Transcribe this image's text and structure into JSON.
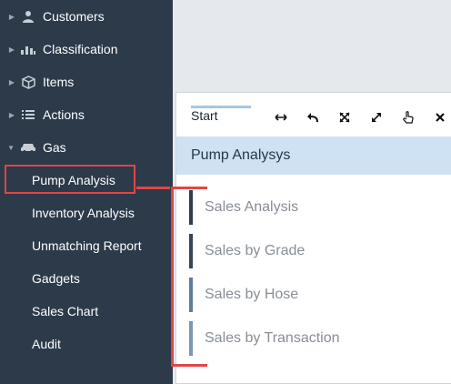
{
  "sidebar": {
    "items": [
      {
        "label": "Customers",
        "icon": "user-icon"
      },
      {
        "label": "Classification",
        "icon": "classification-icon"
      },
      {
        "label": "Items",
        "icon": "box-icon"
      },
      {
        "label": "Actions",
        "icon": "list-icon"
      },
      {
        "label": "Gas",
        "icon": "car-icon",
        "expanded": true
      }
    ],
    "gas_children": [
      {
        "label": "Pump Analysis",
        "selected": true
      },
      {
        "label": "Inventory Analysis"
      },
      {
        "label": "Unmatching Report"
      },
      {
        "label": "Gadgets"
      },
      {
        "label": "Sales Chart"
      },
      {
        "label": "Audit"
      }
    ]
  },
  "panel": {
    "tab_label": "Start",
    "toolbar": [
      "resize-horizontal-icon",
      "undo-icon",
      "fullscreen-icon",
      "expand-icon",
      "pointer-hand-icon",
      "close-icon"
    ],
    "header_title": "Pump Analysys",
    "reports": [
      {
        "label": "Sales Analysis",
        "bar_color": "#2f3e4e"
      },
      {
        "label": "Sales by Grade",
        "bar_color": "#33475b"
      },
      {
        "label": "Sales by Hose",
        "bar_color": "#5f7d9c"
      },
      {
        "label": "Sales by Transaction",
        "bar_color": "#7b97b4"
      }
    ]
  },
  "colors": {
    "sidebar_bg": "#2c3a4a",
    "highlight_red": "#e04646",
    "header_bg": "#cfe2f3",
    "canvas_bg": "#e5e9ee"
  }
}
